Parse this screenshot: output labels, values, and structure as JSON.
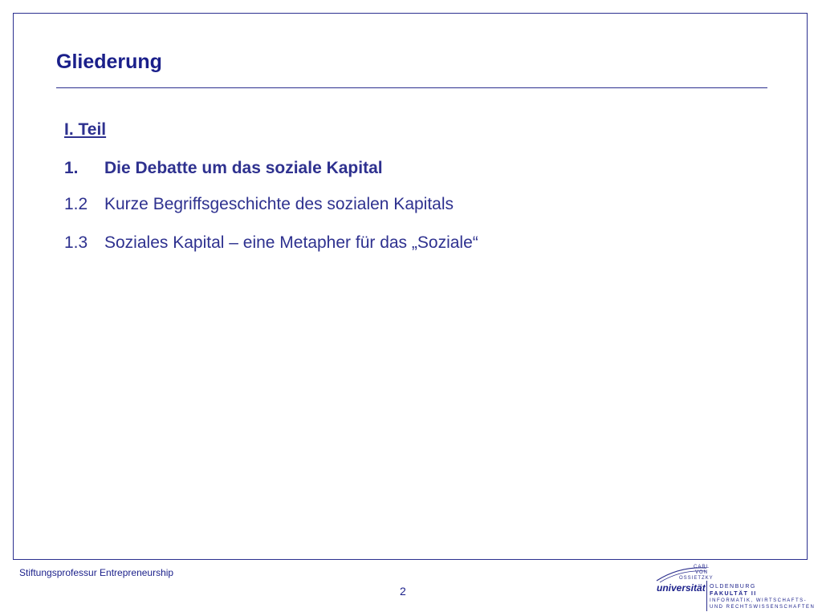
{
  "slide": {
    "title": "Gliederung",
    "part_label": "I. Teil",
    "items": [
      {
        "number": "1.",
        "text": "Die Debatte um das soziale Kapital",
        "bold": true
      },
      {
        "number": "1.2",
        "text": "Kurze Begriffsgeschichte des sozialen Kapitals",
        "bold": false
      },
      {
        "number": "1.3",
        "text": "Soziales Kapital – eine Metapher für das „Soziale“",
        "bold": false
      }
    ]
  },
  "footer": {
    "left_text": "Stiftungsprofessur Entrepreneurship",
    "page_number": "2"
  },
  "logo": {
    "carl": "CARL",
    "von": "VON",
    "ossietzky": "OSSIETZKY",
    "universitaet": "universität",
    "oldenburg": "OLDENBURG",
    "fakultaet": "FAKULTÄT II",
    "line3": "INFORMATIK, WIRTSCHAFTS-",
    "line4": "UND RECHTSWISSENSCHAFTEN"
  },
  "colors": {
    "primary": "#1a1f8a",
    "text": "#2e318f",
    "border": "#2b2f8f",
    "background": "#ffffff"
  }
}
